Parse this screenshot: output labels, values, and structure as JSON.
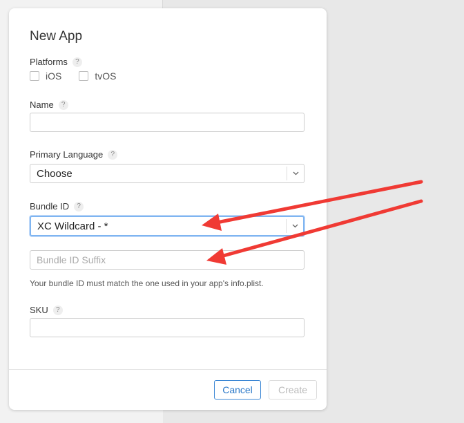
{
  "dialog": {
    "title": "New App",
    "help_glyph": "?",
    "platforms": {
      "label": "Platforms",
      "options": [
        {
          "label": "iOS",
          "checked": false
        },
        {
          "label": "tvOS",
          "checked": false
        }
      ]
    },
    "name": {
      "label": "Name",
      "value": "",
      "placeholder": ""
    },
    "primary_language": {
      "label": "Primary Language",
      "selected": "Choose"
    },
    "bundle_id": {
      "label": "Bundle ID",
      "selected": "XC Wildcard - *",
      "suffix_placeholder": "Bundle ID Suffix",
      "hint": "Your bundle ID must match the one used in your app's info.plist."
    },
    "sku": {
      "label": "SKU",
      "value": ""
    },
    "buttons": {
      "cancel": "Cancel",
      "create": "Create"
    }
  },
  "annotation": {
    "arrow_color": "#f03a34"
  },
  "colors": {
    "accent": "#2a78c8",
    "focus": "#7fb5f1"
  }
}
